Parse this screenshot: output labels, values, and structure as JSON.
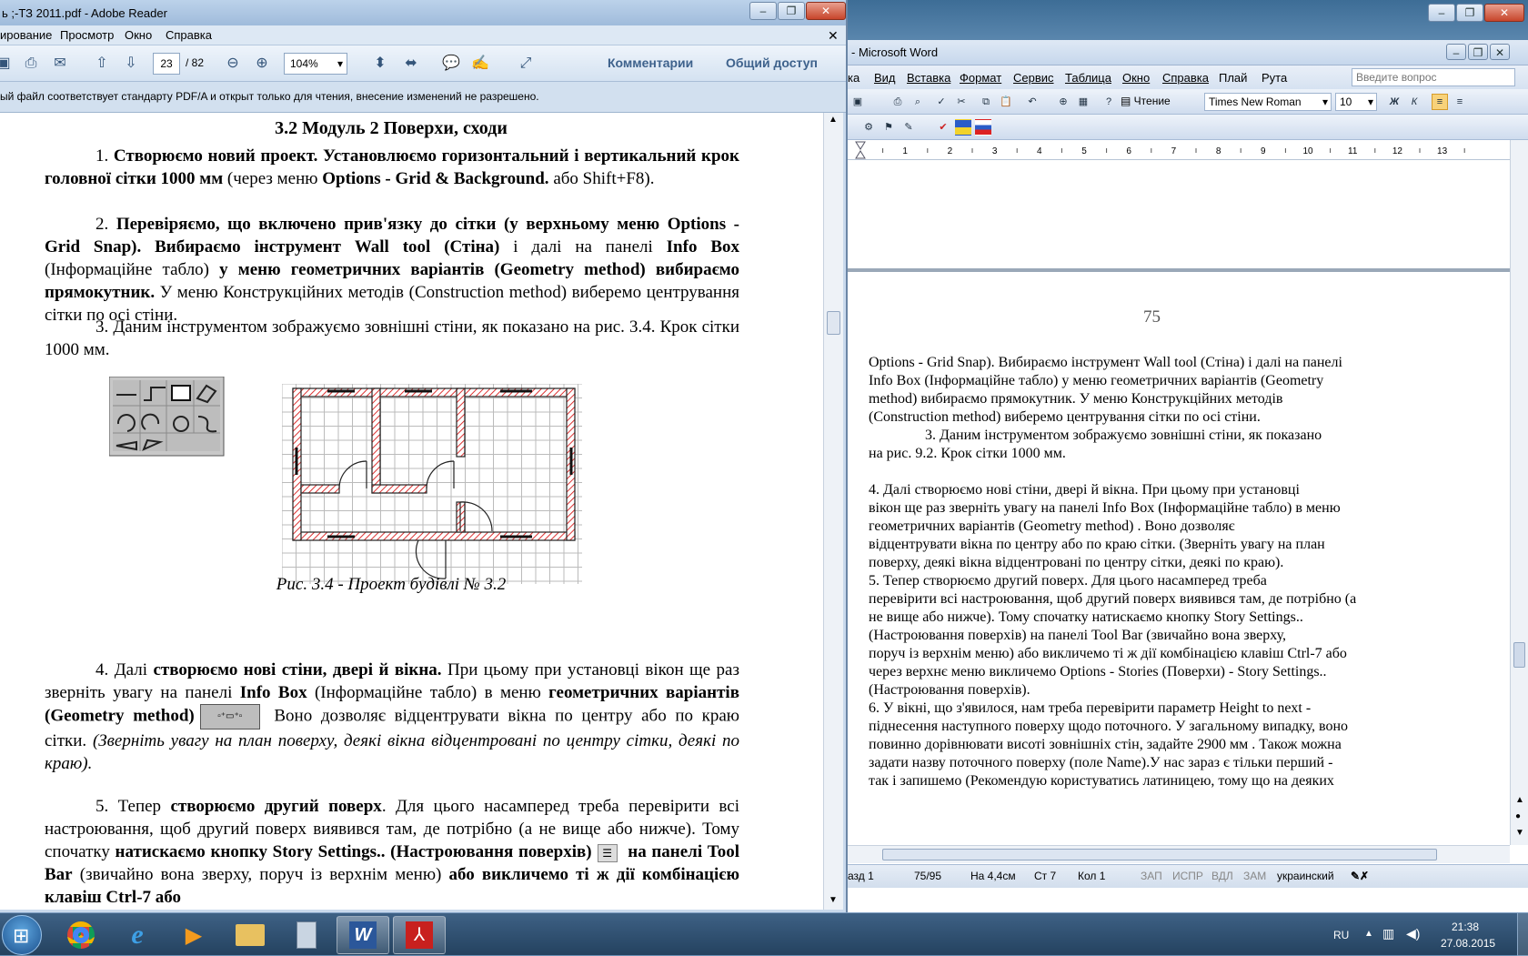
{
  "word": {
    "title": "- Microsoft Word",
    "menu": [
      "ка",
      "Вид",
      "Вставка",
      "Формат",
      "Сервис",
      "Таблица",
      "Окно",
      "Справка",
      "Плай",
      "Рута"
    ],
    "help_placeholder": "Введите вопрос",
    "reading_label": "Чтение",
    "font_name": "Times New Roman",
    "font_size": "10",
    "ruler_marks": [
      "1",
      "2",
      "3",
      "4",
      "5",
      "6",
      "7",
      "8",
      "9",
      "10",
      "11",
      "12",
      "13"
    ],
    "page_number": "75",
    "lines": [
      "Options - Grid Snap). Вибираємо інструмент Wall tool (Стіна) і далі на панелі",
      "Info Box (Інформаційне табло) у меню геометричних варіантів (Geometry",
      "method) вибираємо прямокутник. У меню Конструкційних методів",
      "(Construction method) виберемо центрування сітки по осі стіни.",
      "3. Даним інструментом зображуємо зовнішні стіни, як показано",
      "на рис. 9.2. Крок сітки 1000 мм.",
      "4. Далі створюємо нові стіни, двері й вікна. При цьому при установці",
      "вікон ще раз зверніть увагу на панелі Info Box (Інформаційне табло) в меню",
      "геометричних варіантів (Geometry method) . Воно дозволяє",
      "відцентрувати вікна по центру або по краю сітки. (Зверніть увагу на план",
      "поверху, деякі вікна відцентровані по центру сітки, деякі по краю).",
      "5. Тепер створюємо другий поверх. Для цього насамперед треба",
      "перевірити всі настроювання, щоб другий поверх виявився там, де потрібно (а",
      "не вище або нижче). Тому спочатку натискаємо кнопку Story Settings..",
      "(Настроювання поверхів) на панелі Tool Bar (звичайно вона зверху,",
      "поруч із верхнім меню) або викличемо ті ж дії комбінацією клавіш Ctrl-7 або",
      "через верхнє меню викличемо Options - Stories (Поверхи) - Story Settings..",
      "(Настроювання поверхів).",
      "6. У вікні, що з'явилося, нам треба перевірити параметр Height to next -",
      "піднесення наступного поверху щодо поточного. У загальному випадку, воно",
      "повинно дорівнювати висоті зовнішніх стін, задайте 2900 мм . Також можна",
      "задати назву поточного поверху (поле Name).У нас зараз є тільки перший -",
      "так і запишемо (Рекомендую користуватись латиницею, тому що на деяких"
    ],
    "status": {
      "section": "азд 1",
      "page_of": "75/95",
      "at": "На 4,4см",
      "line": "Ст 7",
      "col": "Кол 1",
      "rec": "ЗАП",
      "trk": "ИСПР",
      "ext": "ВДЛ",
      "ovr": "ЗАМ",
      "lang": "украинский"
    }
  },
  "reader": {
    "title": "ь ;-ТЗ 2011.pdf - Adobe Reader",
    "menu": [
      "ирование",
      "Просмотр",
      "Окно",
      "Справка"
    ],
    "page_current": "23",
    "page_total": "/ 82",
    "zoom": "104%",
    "comments_label": "Комментарии",
    "share_label": "Общий доступ",
    "info_message": "ый файл соответствует стандарту PDF/A и открыт только для чтения, внесение изменений не разрешено.",
    "heading": "3.2 Модуль 2 Поверхи, сходи",
    "p1": [
      "1. ",
      "Створюємо новий проект. Установлюємо горизонтальний і вертикальний крок головної сітки 1000 мм",
      " (через меню ",
      "Options - Grid & Background.",
      " або Shift+F8)."
    ],
    "p2": [
      "2. ",
      "Перевіряємо, що включено прив'язку до сітки (у верхньому меню Options - Grid Snap). Вибираємо інструмент Wall tool (Стіна)",
      " і далі на панелі ",
      "Info Box",
      " (Інформаційне табло) ",
      "у меню геометричних варіантів (Geometry method) вибираємо прямокутник.",
      " У меню Конструкційних методів (Construction method) виберемо центрування сітки по осі стіни."
    ],
    "p3": "3. Даним інструментом зображуємо зовнішні стіни, як показано на рис. 3.4. Крок сітки 1000 мм.",
    "caption": "Рис. 3.4 - Проект будівлі № 3.2",
    "p4": [
      "4. Далі ",
      "створюємо нові стіни, двері й вікна.",
      " При цьому при установці вікон ще раз зверніть увагу на панелі ",
      "Info Box",
      " (Інформаційне табло) в меню ",
      "геометричних варіантів (Geometry method)",
      " Воно дозволяє відцентрувати вікна по центру або по краю сітки. ",
      "(Зверніть увагу на план поверху, деякі вікна відцентровані по центру сітки, деякі по краю)."
    ],
    "p5": [
      "5. Тепер ",
      "створюємо другий поверх",
      ". Для цього насамперед треба перевірити всі настроювання, щоб другий поверх виявився там, де потрібно (а не вище або нижче). Тому спочатку ",
      "натискаємо кнопку Story Settings.. (Настроювання поверхів)",
      " на панелі Tool Bar",
      " (звичайно вона зверху, поруч із верхнім меню) ",
      "або викличемо ті ж дії комбінацією клавіш Ctrl-7 або"
    ]
  },
  "taskbar": {
    "lang": "RU",
    "time": "21:38",
    "date": "27.08.2015"
  }
}
